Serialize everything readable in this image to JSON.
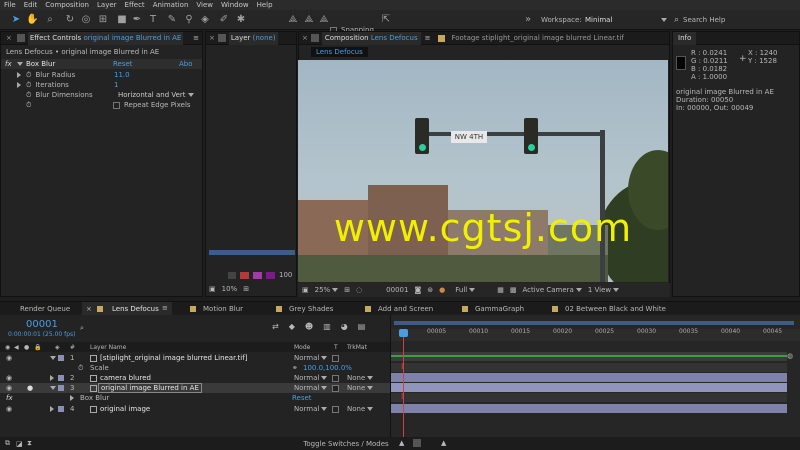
{
  "menu": [
    "File",
    "Edit",
    "Composition",
    "Layer",
    "Effect",
    "Animation",
    "View",
    "Window",
    "Help"
  ],
  "toolbar": {
    "snapping_label": "Snapping",
    "workspace_label": "Workspace:",
    "workspace_value": "Minimal",
    "search_placeholder": "Search Help"
  },
  "effect_controls": {
    "tab_label": "Effect Controls",
    "tab_layer": "original image Blurred in AE",
    "breadcrumb": "Lens Defocus • original image Blurred in AE",
    "effect_name": "Box Blur",
    "reset": "Reset",
    "about": "Abo",
    "params": [
      {
        "label": "Blur Radius",
        "value": "11.0"
      },
      {
        "label": "Iterations",
        "value": "1"
      },
      {
        "label": "Blur Dimensions",
        "value": "Horizontal and Vert"
      },
      {
        "label": "Repeat Edge Pixels",
        "value": ""
      }
    ]
  },
  "layer_panel": {
    "tab_label": "Layer",
    "tab_value": "(none)",
    "zoom": "10%",
    "counter": "100"
  },
  "comp_panel": {
    "tab_label": "Composition",
    "tab_comp": "Lens Defocus",
    "footage_tab": "Footage stiplight_original image blurred Linear.tif",
    "comp_chip": "Lens Defocus",
    "watermark": "www.cgtsj.com",
    "street_sign": "NW 4TH",
    "zoom": "25%",
    "frame": "00001",
    "resolution": "Full",
    "camera": "Active Camera",
    "views": "1 View"
  },
  "info_panel": {
    "title": "Info",
    "r": "R : 0.0241",
    "g": "G : 0.0211",
    "b": "B : 0.0182",
    "a": "A : 1.0000",
    "x": "X : 1240",
    "y": "Y : 1528",
    "layer_name": "original image Blurred in AE",
    "duration": "Duration: 00050",
    "in_out": "In: 00000, Out: 00049"
  },
  "bottom_tabs": [
    {
      "label": "Render Queue",
      "color": ""
    },
    {
      "label": "Lens Defocus",
      "color": "#c8a85a"
    },
    {
      "label": "Motion Blur",
      "color": "#c8a85a"
    },
    {
      "label": "Grey Shades",
      "color": "#c8a85a"
    },
    {
      "label": "Add and Screen",
      "color": "#c8a85a"
    },
    {
      "label": "GammaGraph",
      "color": "#c8a85a"
    },
    {
      "label": "02 Between Black and White",
      "color": "#c8a85a"
    }
  ],
  "timeline": {
    "timecode": "00001",
    "timecode_sub": "0:00:00:01 (25.00 fps)",
    "col_num": "#",
    "col_layer_name": "Layer Name",
    "col_mode": "Mode",
    "col_t": "T",
    "col_trkmat": "TrkMat",
    "rows": [
      {
        "num": "1",
        "name": "[stiplight_original image blurred Linear.tif]",
        "mode": "Normal",
        "trkmat": ""
      },
      {
        "num": "",
        "name": "Scale",
        "value": "100.0,100.0%",
        "sub": true
      },
      {
        "num": "2",
        "name": "camera blured",
        "mode": "Normal",
        "trkmat": "None"
      },
      {
        "num": "3",
        "name": "original image Blurred in AE",
        "mode": "Normal",
        "trkmat": "None"
      },
      {
        "num": "",
        "name": "Box Blur",
        "value": "Reset",
        "sub": true
      },
      {
        "num": "4",
        "name": "original image",
        "mode": "Normal",
        "trkmat": "None"
      }
    ],
    "ruler": [
      "00005",
      "00010",
      "00015",
      "00020",
      "00025",
      "00030",
      "00035",
      "00040",
      "00045"
    ],
    "toggle_label": "Toggle Switches / Modes"
  },
  "colors": {
    "accent": "#4a9ee0",
    "watermark": "#f0f000",
    "playhead": "#d04040",
    "green_bar": "#3aa040",
    "layer_bar": "#8b8fb5"
  }
}
